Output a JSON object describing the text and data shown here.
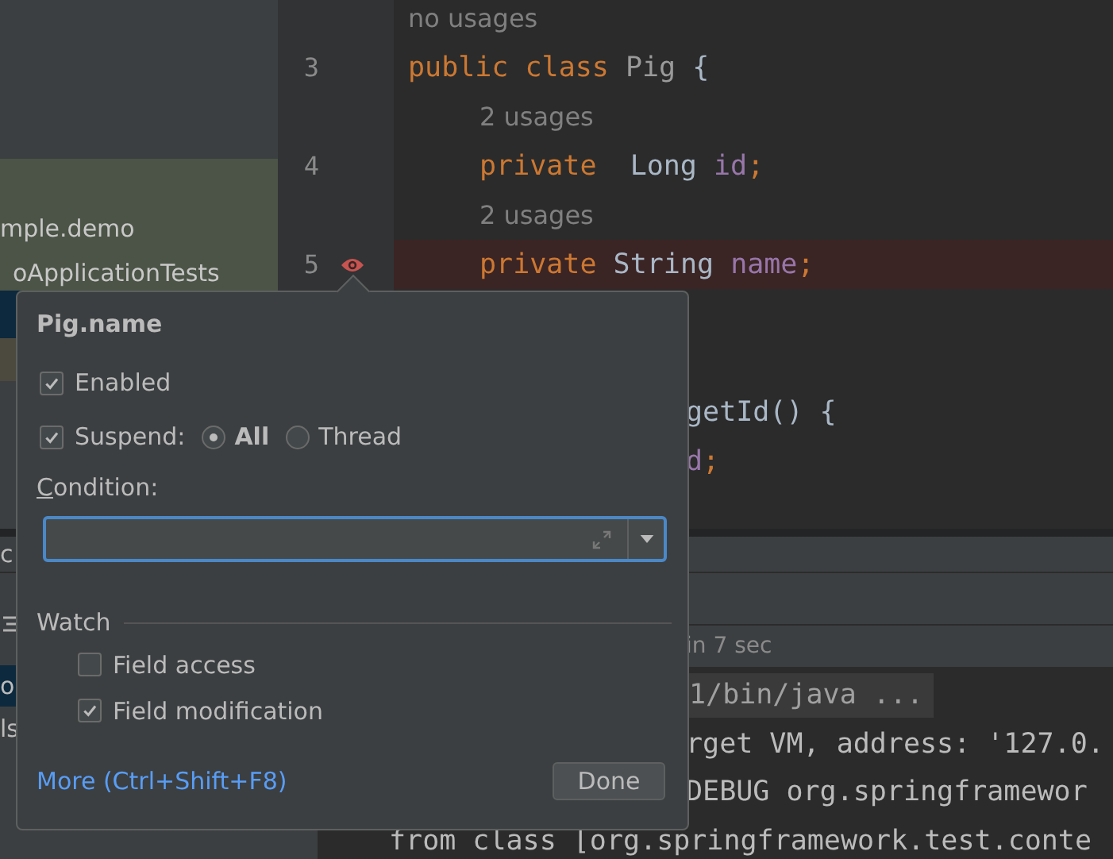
{
  "project_tree": {
    "items": [
      {
        "label": "mple.demo"
      },
      {
        "label": "oApplicationTests"
      }
    ]
  },
  "editor": {
    "lines": [
      {
        "kind": "hint",
        "text": "no usages",
        "indented": false
      },
      {
        "kind": "code",
        "number": "3",
        "breakpoint": false,
        "tokens": [
          {
            "text": "public class ",
            "kind": "keyword"
          },
          {
            "text": "Pig ",
            "kind": "unused"
          },
          {
            "text": "{",
            "kind": "plain"
          }
        ]
      },
      {
        "kind": "hint",
        "text": "2 usages",
        "indented": true
      },
      {
        "kind": "code",
        "number": "4",
        "breakpoint": false,
        "indented": true,
        "tokens": [
          {
            "text": "private  ",
            "kind": "keyword"
          },
          {
            "text": "Long ",
            "kind": "plain"
          },
          {
            "text": "id",
            "kind": "field"
          },
          {
            "text": ";",
            "kind": "keyword"
          }
        ]
      },
      {
        "kind": "hint",
        "text": "2 usages",
        "indented": true
      },
      {
        "kind": "code",
        "number": "5",
        "breakpoint": true,
        "indented": true,
        "tokens": [
          {
            "text": "private ",
            "kind": "keyword"
          },
          {
            "text": "String ",
            "kind": "plain"
          },
          {
            "text": "name",
            "kind": "field"
          },
          {
            "text": ";",
            "kind": "keyword"
          }
        ]
      },
      {
        "kind": "blank"
      },
      {
        "kind": "blank"
      },
      {
        "kind": "fragment",
        "tokens": [
          {
            "text": "getId() {",
            "kind": "plain"
          }
        ]
      },
      {
        "kind": "fragment",
        "tokens": [
          {
            "text": "d",
            "kind": "field"
          },
          {
            "text": ";",
            "kind": "keyword"
          }
        ]
      }
    ]
  },
  "debug_panel": {
    "side_rows": [
      {
        "kind": "text",
        "text": "c",
        "selected": false
      },
      {
        "kind": "icon",
        "selected": false
      },
      {
        "kind": "text",
        "text": "o",
        "selected": true
      },
      {
        "kind": "text",
        "text": "ls",
        "selected": false
      }
    ],
    "status": "in 7 sec",
    "console": [
      {
        "kind": "command",
        "text": "1/bin/java ..."
      },
      {
        "kind": "clipped",
        "text": "rget VM, address: '127.0."
      },
      {
        "kind": "clipped",
        "text": "DEBUG org.springframewor"
      },
      {
        "kind": "full",
        "text": "from class [org.springframework.test.conte"
      }
    ]
  },
  "breakpoint_popup": {
    "title": "Pig.name",
    "enabled": {
      "label": "Enabled",
      "checked": true
    },
    "suspend": {
      "label": "Suspend:",
      "checked": true,
      "options": [
        {
          "label": "All",
          "selected": true
        },
        {
          "label": "Thread",
          "selected": false
        }
      ]
    },
    "condition": {
      "label": "Condition:"
    },
    "watch": {
      "title": "Watch",
      "options": [
        {
          "label": "Field access",
          "checked": false
        },
        {
          "label": "Field modification",
          "checked": true
        }
      ]
    },
    "more_link": "More (Ctrl+Shift+F8)",
    "done_button": "Done"
  }
}
